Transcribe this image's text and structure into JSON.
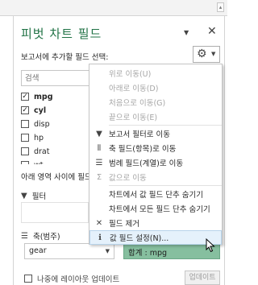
{
  "pane": {
    "title": "피벗 차트 필드",
    "instruction": "보고서에 추가할 필드 선택:",
    "search_placeholder": "검색",
    "areas_label": "아래 영역 사이에 필드를 끌어 놓으십시오.",
    "defer_label": "나중에 레이아웃 업데이트",
    "update_label": "업데이트"
  },
  "fields": [
    {
      "name": "mpg",
      "checked": "✓",
      "bold": true
    },
    {
      "name": "cyl",
      "checked": "✓",
      "bold": true
    },
    {
      "name": "disp",
      "checked": "",
      "bold": false
    },
    {
      "name": "hp",
      "checked": "",
      "bold": false
    },
    {
      "name": "drat",
      "checked": "",
      "bold": false
    },
    {
      "name": "wt",
      "checked": "",
      "bold": false
    }
  ],
  "areas": {
    "filters_label": "필터",
    "axis_label": "축(범주)",
    "axis_item": "gear",
    "value_item": "합계 : mpg"
  },
  "menu": {
    "items": [
      {
        "label": "위로 이동(U)",
        "icon": "",
        "disabled": true
      },
      {
        "label": "아래로 이동(D)",
        "icon": "",
        "disabled": true
      },
      {
        "label": "처음으로 이동(G)",
        "icon": "",
        "disabled": true
      },
      {
        "label": "끝으로 이동(E)",
        "icon": "",
        "disabled": true
      },
      {
        "label": "보고서 필터로 이동",
        "icon": "▼",
        "disabled": false
      },
      {
        "label": "축 필드(항목)로 이동",
        "icon": "⦀",
        "disabled": false
      },
      {
        "label": "범례 필드(계열)로 이동",
        "icon": "☰",
        "disabled": false
      },
      {
        "label": "값으로 이동",
        "icon": "Σ",
        "disabled": true
      },
      {
        "label": "차트에서 값 필드 단추 숨기기",
        "icon": "",
        "disabled": false
      },
      {
        "label": "차트에서 모든 필드 단추 숨기기",
        "icon": "",
        "disabled": false
      },
      {
        "label": "필드 제거",
        "icon": "✕",
        "disabled": false
      },
      {
        "label": "값 필드 설정(N)...",
        "icon": "ℹ",
        "disabled": false,
        "highlighted": true
      }
    ]
  },
  "colors": {
    "accent": "#217346",
    "value_field_bg": "#86bf9f",
    "menu_highlight": "#e5f1fb"
  }
}
